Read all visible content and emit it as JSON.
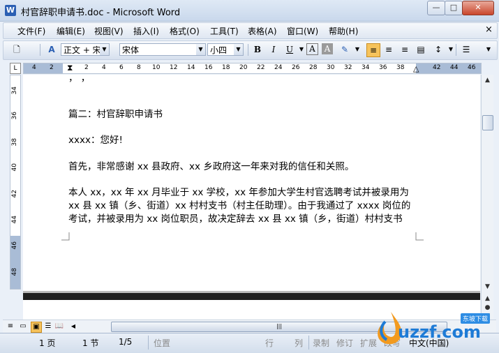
{
  "window": {
    "title": "村官辞职申请书.doc - Microsoft Word",
    "app_icon": "W",
    "minimize": "—",
    "maximize": "□",
    "close": "✕"
  },
  "menu": {
    "items": [
      "文件(F)",
      "编辑(E)",
      "视图(V)",
      "插入(I)",
      "格式(O)",
      "工具(T)",
      "表格(A)",
      "窗口(W)",
      "帮助(H)"
    ],
    "doc_close": "×"
  },
  "toolbar": {
    "style_value": "正文 + 宋体",
    "font_value": "宋体",
    "size_value": "小四",
    "bold": "B",
    "italic": "I",
    "underline": "U",
    "font_color": "A",
    "char_shading": "A"
  },
  "ruler": {
    "tab_selector": "L",
    "numbers": [
      "4",
      "2",
      "2",
      "4",
      "6",
      "8",
      "10",
      "12",
      "14",
      "16",
      "18",
      "20",
      "22",
      "24",
      "26",
      "28",
      "30",
      "32",
      "34",
      "36",
      "38",
      "42",
      "44",
      "46"
    ],
    "vertical_numbers": [
      "34",
      "36",
      "38",
      "40",
      "42",
      "44",
      "46",
      "48"
    ]
  },
  "document": {
    "partial_line": "，     ，",
    "lines": [
      "篇二：村官辞职申请书",
      "xxxx：您好!",
      "首先，非常感谢 xx 县政府、xx 乡政府这一年来对我的信任和关照。",
      "本人 xx，xx 年 xx 月毕业于 xx 学校，xx 年参加大学生村官选聘考试并被录用为",
      "xx 县 xx 镇（乡、街道）xx 村村支书（村主任助理）。由于我通过了 xxxx 岗位的",
      "考试，并被录用为 xx 岗位职员，故决定辞去 xx 县 xx 镇（乡，街道）村村支书"
    ]
  },
  "scroll": {
    "grip": "|||"
  },
  "status": {
    "page": "1 页",
    "section": "1 节",
    "page_of": "1/5",
    "position": "位置",
    "line": "行",
    "column": "列",
    "record": "录制",
    "revise": "修订",
    "extend": "扩展",
    "overwrite": "改写",
    "language": "中文(中国)"
  },
  "watermark": {
    "brand": "uzzf.com",
    "tag": "东坡下载"
  },
  "colors": {
    "accent": "#2b5fb3",
    "watermark": "#1e7bd6"
  }
}
